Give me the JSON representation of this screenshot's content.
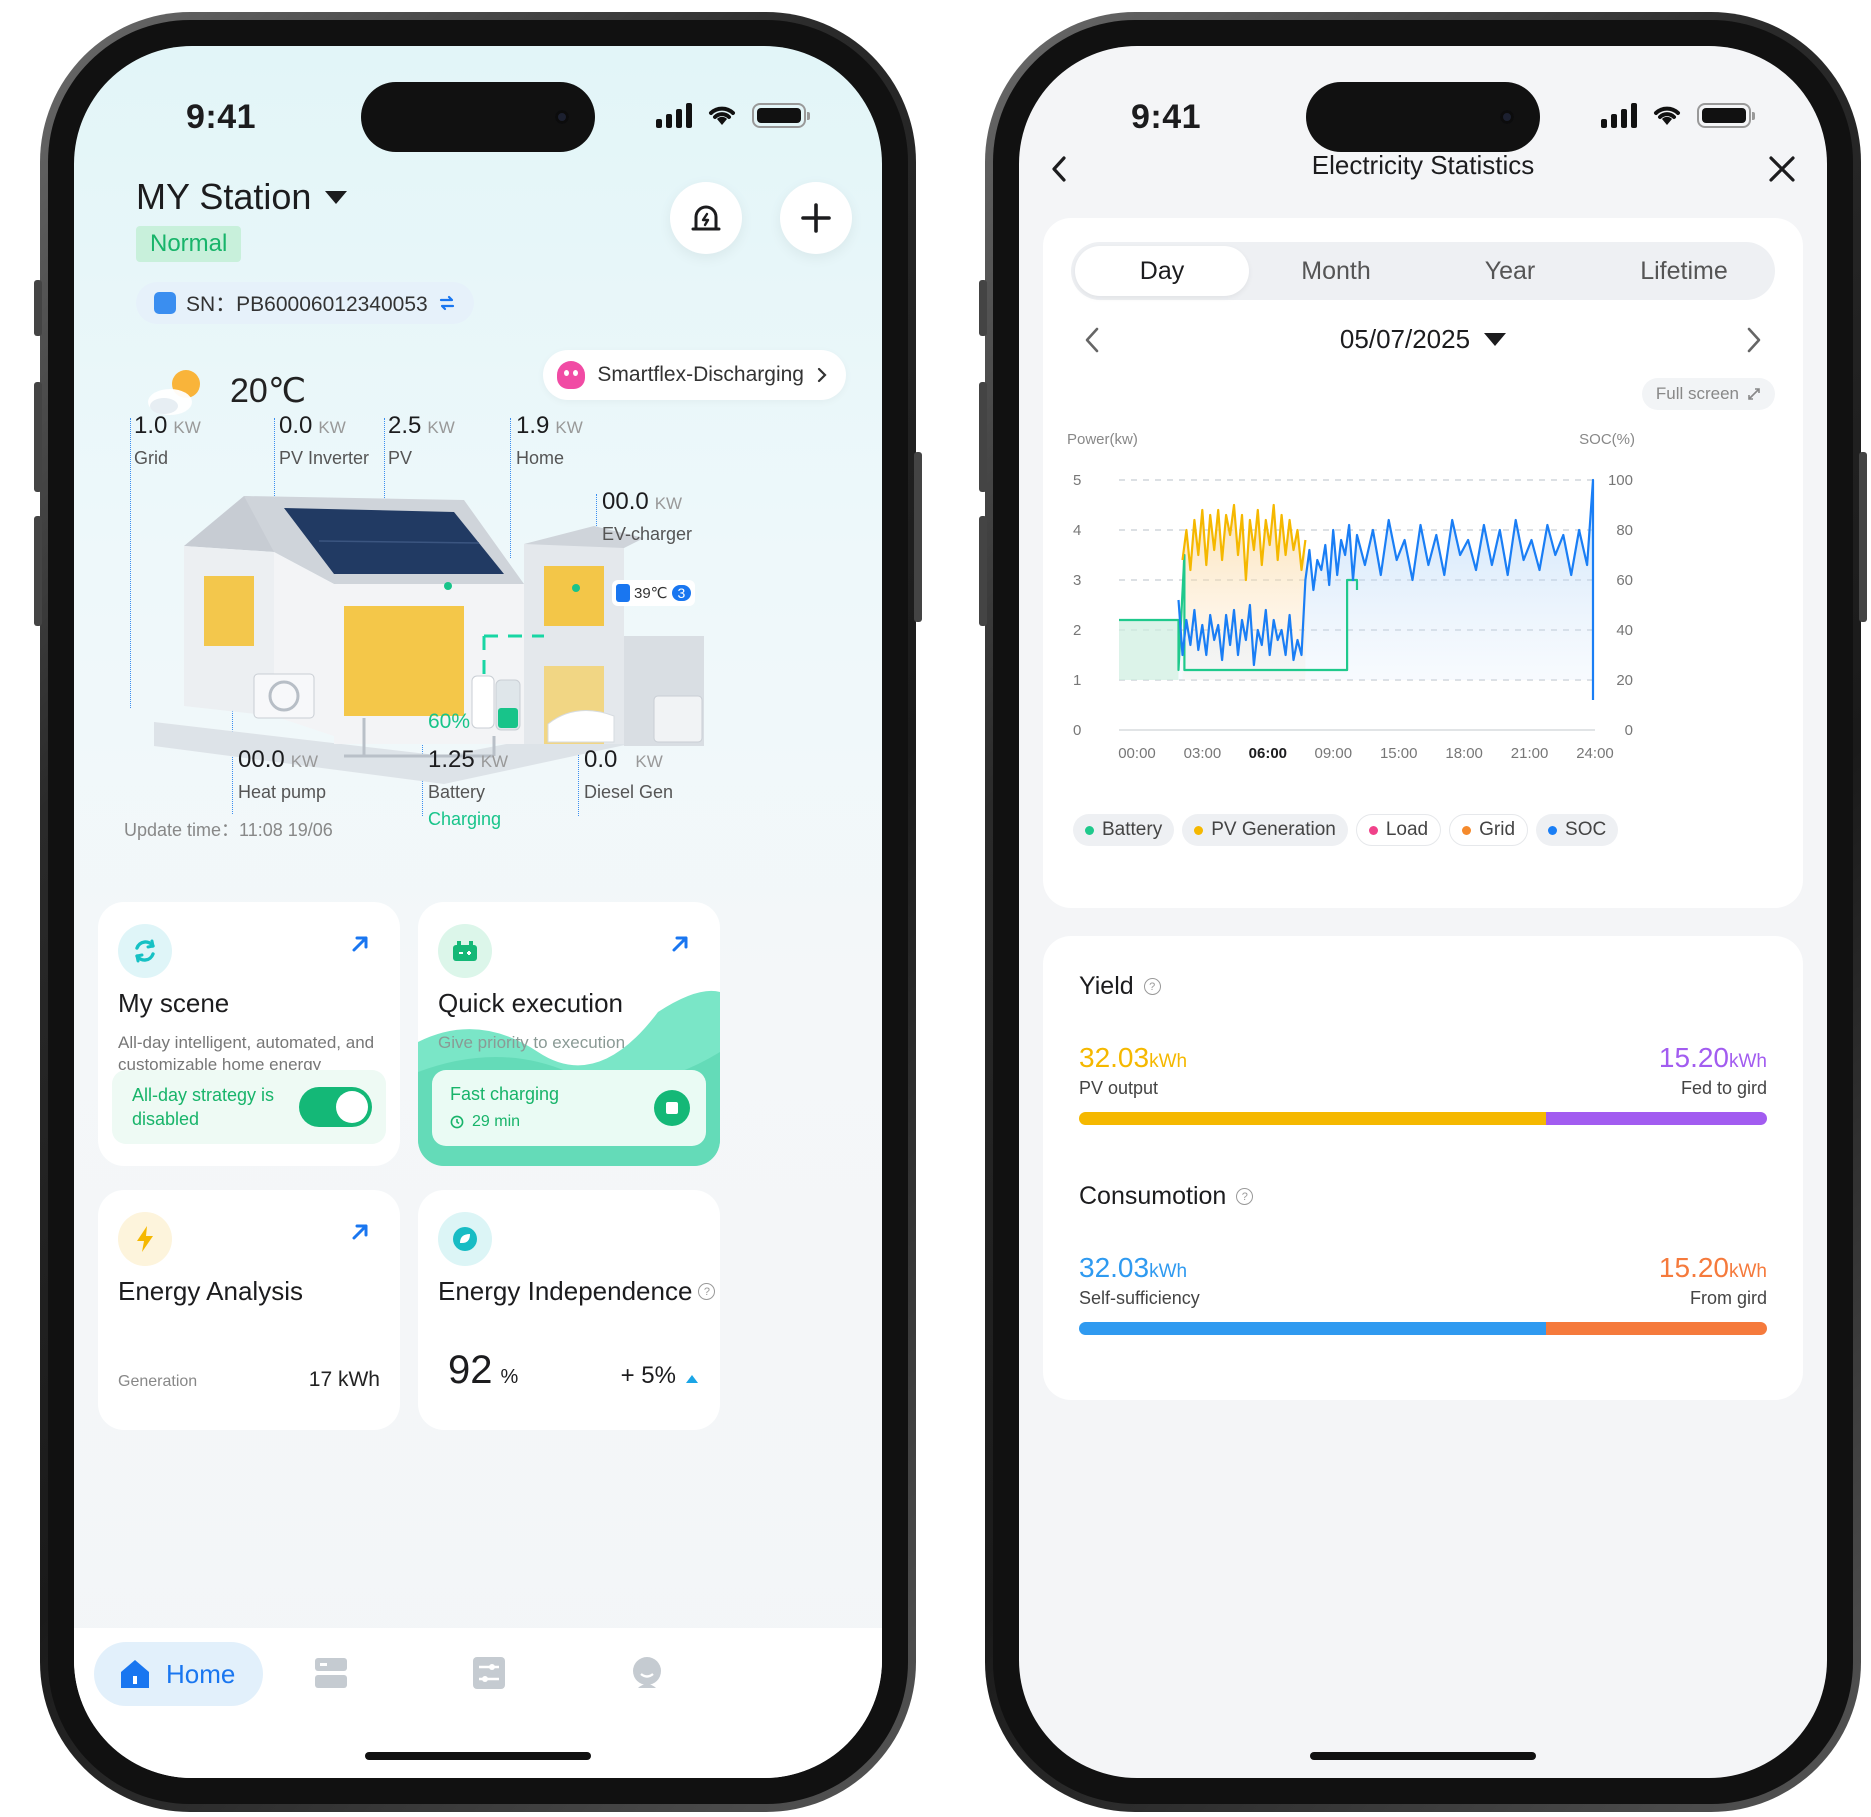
{
  "status": {
    "time": "9:41"
  },
  "home": {
    "station_name": "MY Station",
    "status_badge": "Normal",
    "sn_label": "SN：PB60006012340053",
    "temperature": "20℃",
    "mode_label": "Smartflex-Discharging",
    "metrics": {
      "grid": {
        "value": "1.0",
        "unit": "KW",
        "label": "Grid"
      },
      "pv_inverter": {
        "value": "0.0",
        "unit": "KW",
        "label": "PV Inverter"
      },
      "pv": {
        "value": "2.5",
        "unit": "KW",
        "label": "PV"
      },
      "home": {
        "value": "1.9",
        "unit": "KW",
        "label": "Home"
      },
      "ev_charger": {
        "value": "00.0",
        "unit": "KW",
        "label": "EV-charger"
      },
      "heat_pump": {
        "value": "00.0",
        "unit": "KW",
        "label": "Heat pump"
      },
      "battery": {
        "value": "1.25",
        "unit": "KW",
        "label": "Battery",
        "state": "Charging",
        "soc": "60%"
      },
      "diesel_gen": {
        "value": "0.0",
        "unit": "KW",
        "label": "Diesel Gen"
      }
    },
    "ev_temp": "39℃",
    "ev_count": "3",
    "update_time": "Update time：11:08 19/06",
    "cards": {
      "my_scene": {
        "title": "My scene",
        "desc": "All-day intelligent, automated, and customizable home energy control",
        "strategy": "All-day strategy is disabled"
      },
      "quick_exec": {
        "title": "Quick execution",
        "desc": "Give priority to execution",
        "task": "Fast charging",
        "duration": "29 min"
      },
      "energy_analysis": {
        "title": "Energy Analysis",
        "gen_label": "Generation",
        "gen_value": "17 kWh"
      },
      "energy_independence": {
        "title": "Energy Independence",
        "percent": "92",
        "percent_unit": "%",
        "change": "+ 5%"
      }
    },
    "tabbar": {
      "home_label": "Home"
    },
    "colors": {
      "accent_green": "#14b877",
      "accent_blue": "#1976f0"
    }
  },
  "stats": {
    "title": "Electricity Statistics",
    "tabs": [
      "Day",
      "Month",
      "Year",
      "Lifetime"
    ],
    "active_tab": "Day",
    "date": "05/07/2025",
    "fullscreen_label": "Full screen",
    "legend": [
      {
        "label": "Battery",
        "color": "#1fc98c"
      },
      {
        "label": "PV Generation",
        "color": "#f5b800"
      },
      {
        "label": "Load",
        "color": "#f0428a"
      },
      {
        "label": "Grid",
        "color": "#f58a2c"
      },
      {
        "label": "SOC",
        "color": "#1a7ef5"
      }
    ],
    "yield": {
      "title": "Yield",
      "left_value": "32.03",
      "left_unit": "kWh",
      "left_label": "PV output",
      "left_color": "#f5b800",
      "right_value": "15.20",
      "right_unit": "kWh",
      "right_label": "Fed to gird",
      "right_color": "#a25cf0"
    },
    "consumption": {
      "title": "Consumotion",
      "left_value": "32.03",
      "left_unit": "kWh",
      "left_label": "Self-sufficiency",
      "left_color": "#2f9af0",
      "right_value": "15.20",
      "right_unit": "kWh",
      "right_label": "From gird",
      "right_color": "#f57a3c"
    }
  },
  "chart_data": {
    "type": "line",
    "y_left_label": "Power(kw)",
    "y_right_label": "SOC(%)",
    "y_left_ticks": [
      "0",
      "1",
      "2",
      "3",
      "4",
      "5"
    ],
    "y_right_ticks": [
      "0",
      "20",
      "40",
      "60",
      "80",
      "100"
    ],
    "x_ticks": [
      "00:00",
      "03:00",
      "06:00",
      "09:00",
      "15:00",
      "18:00",
      "21:00",
      "24:00"
    ],
    "x_tick_highlight": "06:00",
    "ylim": [
      0,
      5
    ],
    "y2lim": [
      0,
      100
    ],
    "series": [
      {
        "name": "Battery",
        "color": "#1fc98c",
        "points": [
          [
            0,
            2.2
          ],
          [
            3,
            2.2
          ],
          [
            3,
            1.2
          ],
          [
            3.3,
            3.5
          ],
          [
            3.3,
            1.2
          ],
          [
            11.5,
            1.2
          ],
          [
            11.5,
            3.0
          ],
          [
            12,
            3.0
          ],
          [
            12,
            2.8
          ]
        ]
      },
      {
        "name": "PV Generation",
        "color": "#f5b800",
        "points": [
          [
            3.2,
            3.4
          ],
          [
            3.4,
            4.0
          ],
          [
            3.6,
            3.2
          ],
          [
            3.8,
            4.2
          ],
          [
            4.0,
            3.5
          ],
          [
            4.2,
            4.4
          ],
          [
            4.4,
            3.3
          ],
          [
            4.6,
            4.3
          ],
          [
            4.8,
            3.6
          ],
          [
            5.0,
            4.4
          ],
          [
            5.2,
            3.4
          ],
          [
            5.4,
            4.3
          ],
          [
            5.6,
            3.9
          ],
          [
            5.8,
            4.5
          ],
          [
            6.0,
            3.5
          ],
          [
            6.2,
            4.3
          ],
          [
            6.4,
            3.0
          ],
          [
            6.6,
            4.2
          ],
          [
            6.8,
            3.6
          ],
          [
            7.0,
            4.4
          ],
          [
            7.2,
            3.3
          ],
          [
            7.4,
            4.2
          ],
          [
            7.6,
            3.7
          ],
          [
            7.8,
            4.5
          ],
          [
            8.0,
            3.4
          ],
          [
            8.2,
            4.3
          ],
          [
            8.4,
            3.5
          ],
          [
            8.6,
            4.2
          ],
          [
            8.8,
            3.6
          ],
          [
            9.0,
            4.0
          ],
          [
            9.2,
            3.2
          ],
          [
            9.4,
            3.8
          ]
        ]
      },
      {
        "name": "SOC",
        "color": "#1a7ef5",
        "points": [
          [
            3,
            52
          ],
          [
            3.2,
            30
          ],
          [
            3.4,
            44
          ],
          [
            3.6,
            34
          ],
          [
            3.8,
            48
          ],
          [
            4.0,
            32
          ],
          [
            4.2,
            42
          ],
          [
            4.4,
            30
          ],
          [
            4.6,
            46
          ],
          [
            4.8,
            36
          ],
          [
            5.0,
            42
          ],
          [
            5.2,
            28
          ],
          [
            5.4,
            46
          ],
          [
            5.6,
            34
          ],
          [
            5.8,
            48
          ],
          [
            6.0,
            30
          ],
          [
            6.2,
            44
          ],
          [
            6.4,
            36
          ],
          [
            6.6,
            50
          ],
          [
            6.8,
            26
          ],
          [
            7.0,
            40
          ],
          [
            7.2,
            34
          ],
          [
            7.4,
            48
          ],
          [
            7.6,
            30
          ],
          [
            7.8,
            44
          ],
          [
            8.0,
            36
          ],
          [
            8.2,
            40
          ],
          [
            8.4,
            30
          ],
          [
            8.6,
            46
          ],
          [
            8.8,
            28
          ],
          [
            9.0,
            36
          ],
          [
            9.2,
            30
          ],
          [
            9.4,
            60
          ],
          [
            9.6,
            72
          ],
          [
            9.8,
            56
          ],
          [
            10.0,
            68
          ],
          [
            10.2,
            64
          ],
          [
            10.4,
            74
          ],
          [
            10.6,
            58
          ],
          [
            10.8,
            80
          ],
          [
            11.0,
            62
          ],
          [
            11.2,
            76
          ],
          [
            11.4,
            70
          ],
          [
            11.6,
            82
          ],
          [
            11.8,
            60
          ],
          [
            12.0,
            78
          ],
          [
            12.4,
            66
          ],
          [
            12.8,
            80
          ],
          [
            13.2,
            62
          ],
          [
            13.6,
            84
          ],
          [
            14.0,
            68
          ],
          [
            14.4,
            76
          ],
          [
            14.8,
            60
          ],
          [
            15.2,
            82
          ],
          [
            15.6,
            66
          ],
          [
            16.0,
            78
          ],
          [
            16.4,
            62
          ],
          [
            16.8,
            84
          ],
          [
            17.2,
            70
          ],
          [
            17.6,
            76
          ],
          [
            18.0,
            64
          ],
          [
            18.4,
            82
          ],
          [
            18.8,
            66
          ],
          [
            19.2,
            80
          ],
          [
            19.6,
            62
          ],
          [
            20.0,
            84
          ],
          [
            20.4,
            68
          ],
          [
            20.8,
            76
          ],
          [
            21.2,
            64
          ],
          [
            21.6,
            82
          ],
          [
            22.0,
            70
          ],
          [
            22.4,
            78
          ],
          [
            22.8,
            62
          ],
          [
            23.2,
            80
          ],
          [
            23.6,
            66
          ],
          [
            23.9,
            100
          ],
          [
            23.9,
            12
          ]
        ]
      }
    ]
  }
}
